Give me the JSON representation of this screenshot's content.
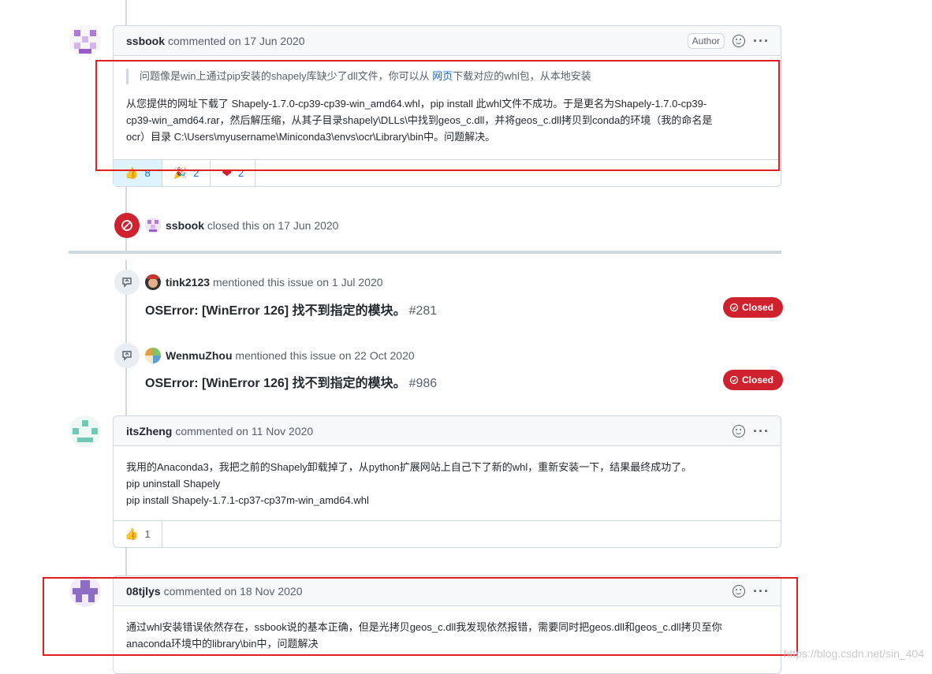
{
  "comments": [
    {
      "author": "ssbook",
      "meta": "commented on 17 Jun 2020",
      "badge": "Author",
      "quote_before": "问题像是win上通过pip安装的shapely库缺少了dll文件，你可以从 ",
      "quote_link": "网页",
      "quote_after": "下载对应的whl包，从本地安装",
      "lines": [
        "从您提供的网址下载了 Shapely-1.7.0-cp39-cp39-win_amd64.whl，pip install 此whl文件不成功。于是更名为Shapely-1.7.0-cp39-",
        "cp39-win_amd64.rar，然后解压缩，从其子目录shapely\\DLLs\\中找到geos_c.dll，并将geos_c.dll拷贝到conda的环境（我的命名是",
        "ocr）目录 C:\\Users\\myusername\\Miniconda3\\envs\\ocr\\Library\\bin中。问题解决。"
      ],
      "reactions": [
        {
          "icon": "thumbs-up-icon",
          "count": "8"
        },
        {
          "icon": "tada-icon",
          "count": "2"
        },
        {
          "icon": "heart-icon",
          "count": "2"
        }
      ]
    },
    {
      "author": "itsZheng",
      "meta": "commented on 11 Nov 2020",
      "lines": [
        "我用的Anaconda3，我把之前的Shapely卸载掉了，从python扩展网站上自己下了新的whl，重新安装一下，结果最终成功了。",
        "pip uninstall Shapely",
        "pip install Shapely-1.7.1-cp37-cp37m-win_amd64.whl"
      ],
      "reactions": [
        {
          "icon": "thumbs-up-icon",
          "count": "1"
        }
      ]
    },
    {
      "author": "08tjlys",
      "meta": "commented on 18 Nov 2020",
      "lines": [
        "通过whl安装错误依然存在，ssbook说的基本正确，但是光拷贝geos_c.dll我发现依然报错，需要同时把geos.dll和geos_c.dll拷贝至你",
        "anaconda环境中的library\\bin中，问题解决"
      ]
    }
  ],
  "closed_event": {
    "who": "ssbook",
    "text": "closed this on 17 Jun 2020"
  },
  "mentions": [
    {
      "who": "tink2123",
      "text": "mentioned this issue on 1 Jul 2020",
      "title": "OSError: [WinError 126] 找不到指定的模块。",
      "number": "#281",
      "state": "Closed"
    },
    {
      "who": "WenmuZhou",
      "text": "mentioned this issue on 22 Oct 2020",
      "title": "OSError: [WinError 126] 找不到指定的模块。",
      "number": "#986",
      "state": "Closed"
    }
  ],
  "watermark": "https://blog.csdn.net/sin_404",
  "colors": {
    "closed": "#cf222e",
    "link": "#0969da",
    "highlight_box": "#e02020"
  }
}
